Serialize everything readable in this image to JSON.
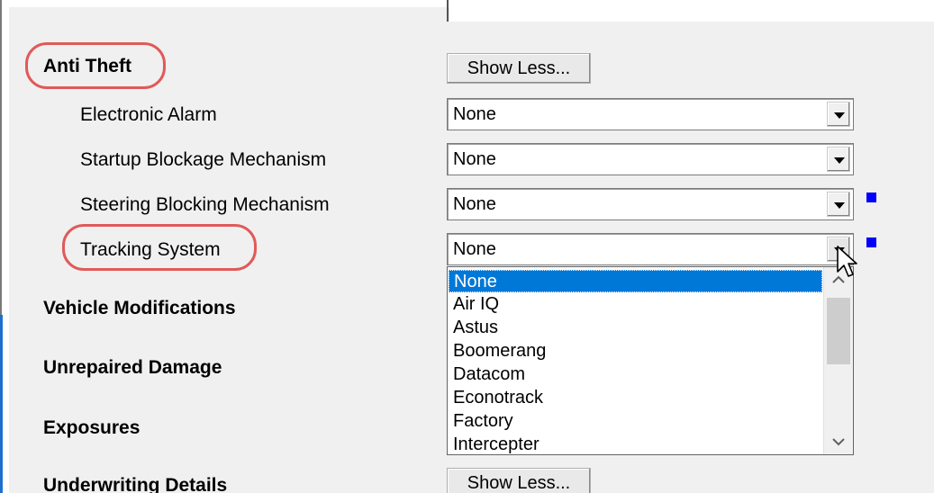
{
  "anti_theft": {
    "title": "Anti Theft",
    "show_less_label": "Show Less...",
    "fields": [
      {
        "label": "Electronic Alarm",
        "value": "None"
      },
      {
        "label": "Startup Blockage Mechanism",
        "value": "None"
      },
      {
        "label": "Steering Blocking Mechanism",
        "value": "None"
      },
      {
        "label": "Tracking System",
        "value": "None"
      }
    ]
  },
  "sections": {
    "vehicle_modifications": "Vehicle Modifications",
    "unrepaired_damage": "Unrepaired Damage",
    "exposures": "Exposures",
    "underwriting_details": "Underwriting Details",
    "underwriting_show_less": "Show Less..."
  },
  "tracking_dropdown": {
    "selected": "None",
    "options": [
      "None",
      "Air IQ",
      "Astus",
      "Boomerang",
      "Datacom",
      "Econotrack",
      "Factory",
      "Intercepter"
    ]
  },
  "colors": {
    "annotation_oval": "#e05a5a",
    "selection": "#0078d7",
    "marker": "#0000ff"
  },
  "icons": {
    "dropdown_arrow": "chevron-down-icon",
    "scroll_up": "scroll-up-icon",
    "scroll_down": "scroll-down-icon",
    "cursor": "mouse-pointer-icon",
    "marker": "required-marker-icon"
  }
}
